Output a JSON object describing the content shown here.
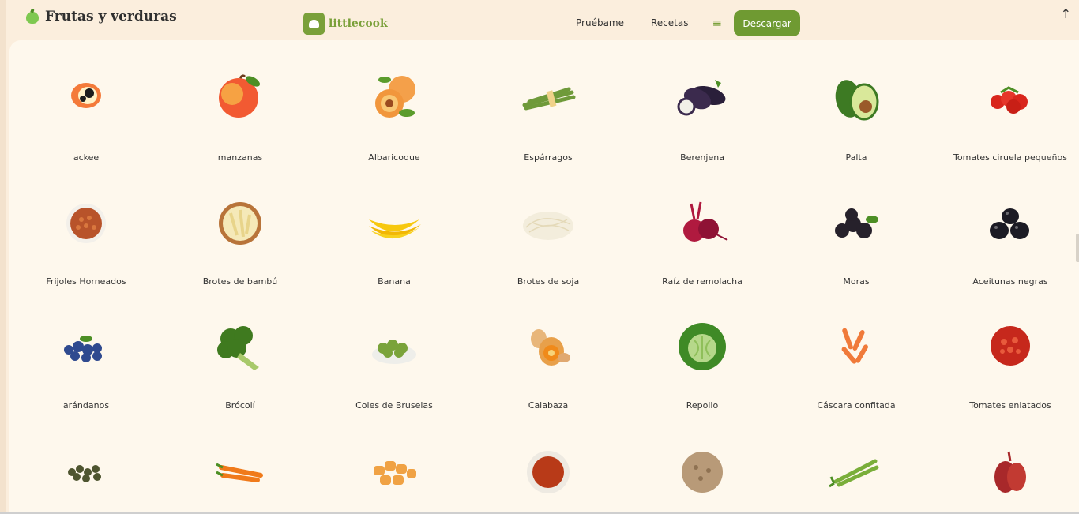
{
  "header": {
    "page_title": "Frutas y verduras",
    "page_title_icon": "green-apple-icon",
    "brand": "littlecook",
    "brand_icon": "chef-hat-icon",
    "nav": [
      "Pruébame",
      "Recetas"
    ],
    "menu_icon": "hamburger-menu-icon",
    "menu_glyph": "≡",
    "download_label": "Descargar",
    "scroll_top_icon": "arrow-up-icon",
    "scroll_top_glyph": "↑"
  },
  "colors": {
    "accent": "#6f9a32",
    "background": "#fbeedd",
    "panel": "#fef8ed"
  },
  "grid": {
    "rows": [
      [
        {
          "label": "ackee",
          "icon": "ackee-icon"
        },
        {
          "label": "manzanas",
          "icon": "apple-icon"
        },
        {
          "label": "Albaricoque",
          "icon": "apricot-icon"
        },
        {
          "label": "Espárragos",
          "icon": "asparagus-icon"
        },
        {
          "label": "Berenjena",
          "icon": "eggplant-icon"
        },
        {
          "label": "Palta",
          "icon": "avocado-icon"
        },
        {
          "label": "Tomates ciruela pequeños",
          "icon": "cherry-tomatoes-icon"
        }
      ],
      [
        {
          "label": "Frijoles Horneados",
          "icon": "baked-beans-icon"
        },
        {
          "label": "Brotes de bambú",
          "icon": "bamboo-shoots-icon"
        },
        {
          "label": "Banana",
          "icon": "banana-icon"
        },
        {
          "label": "Brotes de soja",
          "icon": "bean-sprouts-icon"
        },
        {
          "label": "Raíz de remolacha",
          "icon": "beetroot-icon"
        },
        {
          "label": "Moras",
          "icon": "blackberries-icon"
        },
        {
          "label": "Aceitunas negras",
          "icon": "black-olives-icon"
        }
      ],
      [
        {
          "label": "arándanos",
          "icon": "blueberries-icon"
        },
        {
          "label": "Brócolí",
          "icon": "broccoli-icon"
        },
        {
          "label": "Coles de Bruselas",
          "icon": "brussels-sprouts-icon"
        },
        {
          "label": "Calabaza",
          "icon": "butternut-squash-icon"
        },
        {
          "label": "Repollo",
          "icon": "cabbage-icon"
        },
        {
          "label": "Cáscara confitada",
          "icon": "candied-peel-icon"
        },
        {
          "label": "Tomates enlatados",
          "icon": "canned-tomatoes-icon"
        }
      ],
      [
        {
          "label": "",
          "icon": "capers-icon"
        },
        {
          "label": "",
          "icon": "carrots-icon"
        },
        {
          "label": "",
          "icon": "tater-tots-icon"
        },
        {
          "label": "",
          "icon": "paprika-bowl-icon"
        },
        {
          "label": "",
          "icon": "celeriac-icon"
        },
        {
          "label": "",
          "icon": "celery-icon"
        },
        {
          "label": "",
          "icon": "shallot-icon"
        }
      ]
    ]
  }
}
